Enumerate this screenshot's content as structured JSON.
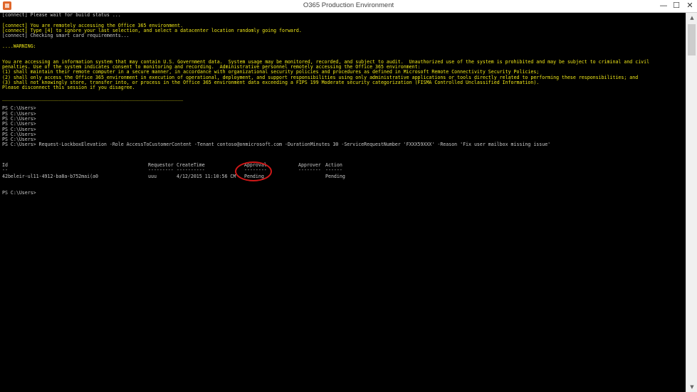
{
  "window": {
    "title": "O365 Production Environment",
    "minimize": "—",
    "maximize": "☐",
    "close": "✕"
  },
  "console": {
    "lines": [
      {
        "text": "[connect] Please wait for build status ...",
        "color": "white"
      },
      {
        "text": "",
        "color": "white"
      },
      {
        "text": "[connect] You are remotely accessing the Office 365 environment.",
        "color": "yellow"
      },
      {
        "text": "[connect] Type [4] to ignore your last selection, and select a datacenter location randomly going forward.",
        "color": "yellow"
      },
      {
        "text": "[connect] Checking smart card requirements...",
        "color": "white"
      },
      {
        "text": "",
        "color": "white"
      },
      {
        "text": "....WARNING:",
        "color": "yellow"
      },
      {
        "text": "",
        "color": "white"
      },
      {
        "text": "",
        "color": "white"
      },
      {
        "text": "You are accessing an information system that may contain U.S. Government data.  System usage may be monitored, recorded, and subject to audit.  Unauthorized use of the system is prohibited and may be subject to criminal and civil",
        "color": "yellow"
      },
      {
        "text": "penalties. Use of the system indicates consent to monitoring and recording.  Administrative personnel remotely accessing the Office 365 environment:",
        "color": "yellow"
      },
      {
        "text": "(1) shall maintain their remote computer in a secure manner, in accordance with organizational security policies and procedures as defined in Microsoft Remote Connectivity Security Policies;",
        "color": "yellow"
      },
      {
        "text": "(2) shall only access the Office 365 environment in execution of operational, deployment, and support responsibilities using only administrative applications or tools directly related to performing these responsibilities; and",
        "color": "yellow"
      },
      {
        "text": "(3) shall not knowingly store, transfer into, or process in the Office 365 environment data exceeding a FIPS 199 Moderate security categorization (FISMA Controlled Unclassified Information).",
        "color": "yellow"
      },
      {
        "text": "Please disconnect this session if you disagree.",
        "color": "yellow"
      },
      {
        "text": "",
        "color": "white"
      },
      {
        "text": "________________________________________________________________",
        "color": "yellow"
      },
      {
        "text": "",
        "color": "white"
      },
      {
        "text": "PS C:\\Users>",
        "color": "white"
      },
      {
        "text": "PS C:\\Users>",
        "color": "white"
      },
      {
        "text": "PS C:\\Users>",
        "color": "white"
      },
      {
        "text": "PS C:\\Users>",
        "color": "white"
      },
      {
        "text": "PS C:\\Users>",
        "color": "white"
      },
      {
        "text": "PS C:\\Users>",
        "color": "white"
      },
      {
        "text": "PS C:\\Users>",
        "color": "white"
      },
      {
        "text": "PS C:\\Users> Request-LockboxElevation -Role AccessToCustomerContent -Tenant contoso@onmicrosoft.com -DurationMinutes 30 -ServiceRequestNumber 'FXXX59XXX' -Reason 'Fix user mailbox missing issue'",
        "color": "white"
      }
    ],
    "table": {
      "headers": [
        "Id",
        "Requestor",
        "CreateTime",
        "Approval",
        "Approver",
        "Action"
      ],
      "underlines": [
        "--",
        "---------",
        "----------",
        "--------",
        "--------",
        "------"
      ],
      "rows": [
        [
          "42beleir-ul11-4912-ba8a-b752mai(a0",
          "uuu",
          "4/12/2015 11:10:56 CM",
          "Pending",
          "",
          "Pending"
        ]
      ]
    },
    "prompt_after": "PS C:\\Users>"
  },
  "scrollbar": {
    "up_arrow": "▲",
    "down_arrow": "▼"
  }
}
